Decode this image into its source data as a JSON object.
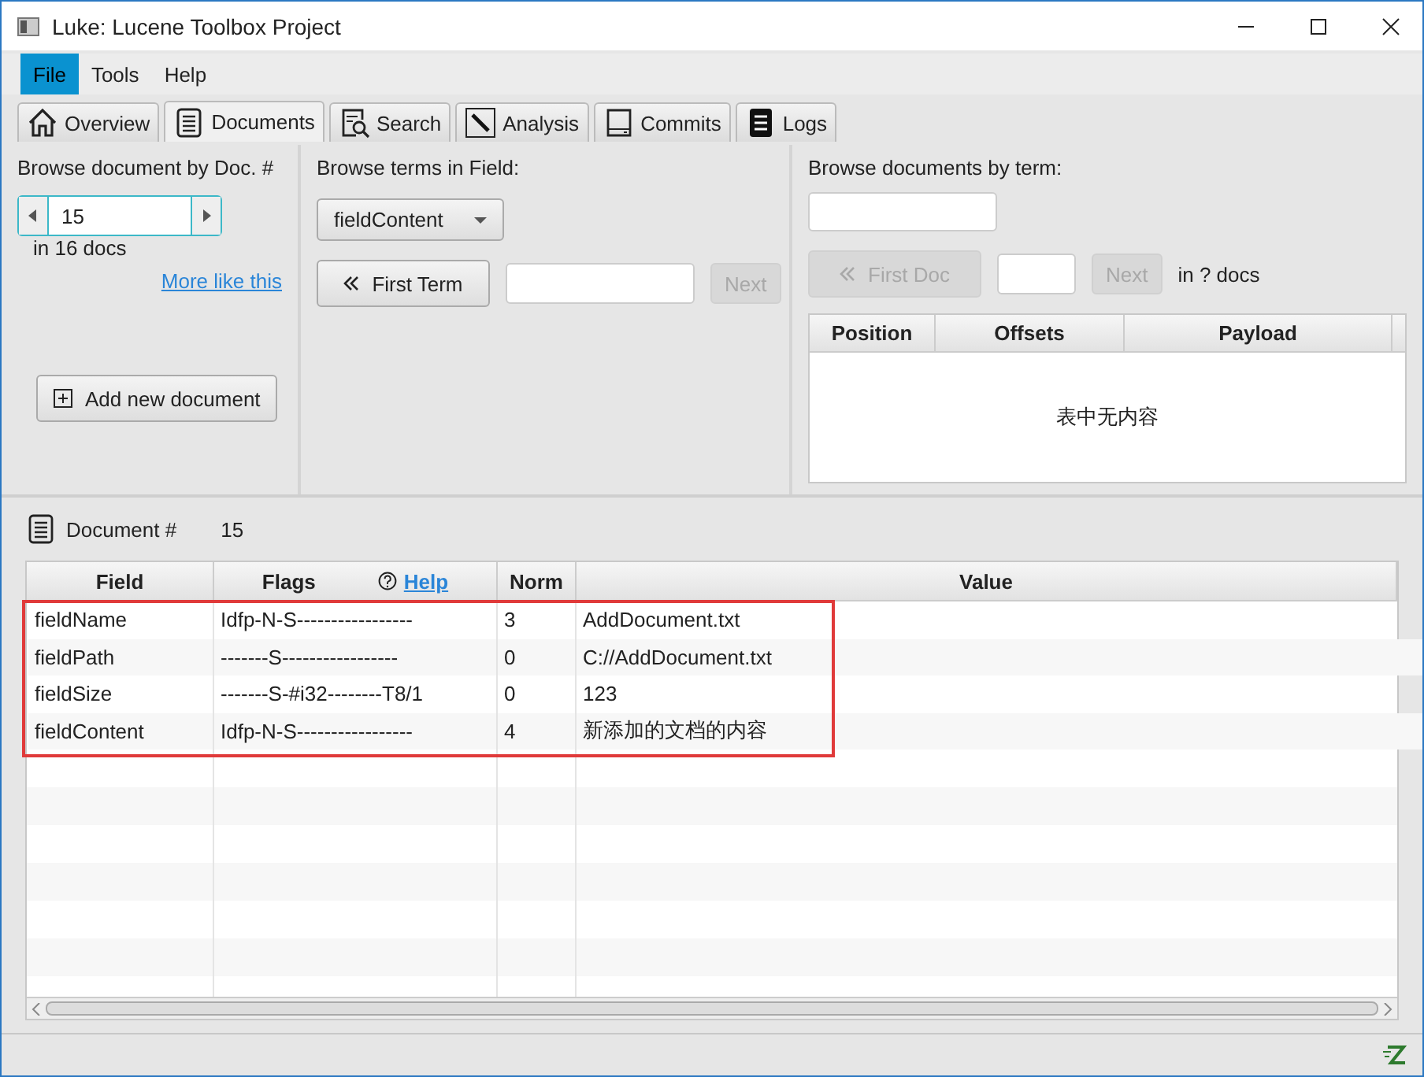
{
  "window": {
    "title": "Luke: Lucene Toolbox Project"
  },
  "menu": [
    {
      "label": "File",
      "selected": true
    },
    {
      "label": "Tools",
      "selected": false
    },
    {
      "label": "Help",
      "selected": false
    }
  ],
  "tabs": [
    {
      "label": "Overview",
      "kind": "home",
      "selected": false
    },
    {
      "label": "Documents",
      "kind": "document",
      "selected": true
    },
    {
      "label": "Search",
      "kind": "search",
      "selected": false
    },
    {
      "label": "Analysis",
      "kind": "wand",
      "selected": false
    },
    {
      "label": "Commits",
      "kind": "drive",
      "selected": false
    },
    {
      "label": "Logs",
      "kind": "logs",
      "selected": false
    }
  ],
  "browse_by_doc": {
    "title": "Browse document by Doc. #",
    "doc_number": "15",
    "count": "in 16 docs",
    "more_like_this": "More like this",
    "add_button": "Add new document"
  },
  "browse_terms": {
    "title": "Browse terms in Field:",
    "field": "fieldContent",
    "first_term": "First Term",
    "next": "Next",
    "next_disabled": true
  },
  "browse_by_term": {
    "title": "Browse documents by term:",
    "first_doc": "First Doc",
    "first_doc_disabled": true,
    "next": "Next",
    "next_disabled": true,
    "count": "in ? docs",
    "columns": [
      "Position",
      "Offsets",
      "Payload"
    ],
    "empty_message": "表中无内容"
  },
  "document": {
    "label": "Document #",
    "number": "15",
    "columns": [
      {
        "label": "Field"
      },
      {
        "label": "Flags",
        "help": "Help"
      },
      {
        "label": "Norm"
      },
      {
        "label": "Value"
      }
    ],
    "rows": [
      {
        "field": "fieldName",
        "flags": "Idfp-N-S-----------------",
        "norm": "3",
        "value": "AddDocument.txt"
      },
      {
        "field": "fieldPath",
        "flags": "-------S-----------------",
        "norm": "0",
        "value": "C://AddDocument.txt"
      },
      {
        "field": "fieldSize",
        "flags": "-------S-#i32--------T8/1",
        "norm": "0",
        "value": "123"
      },
      {
        "field": "fieldContent",
        "flags": "Idfp-N-S-----------------",
        "norm": "4",
        "value": "新添加的文档的内容"
      }
    ]
  }
}
